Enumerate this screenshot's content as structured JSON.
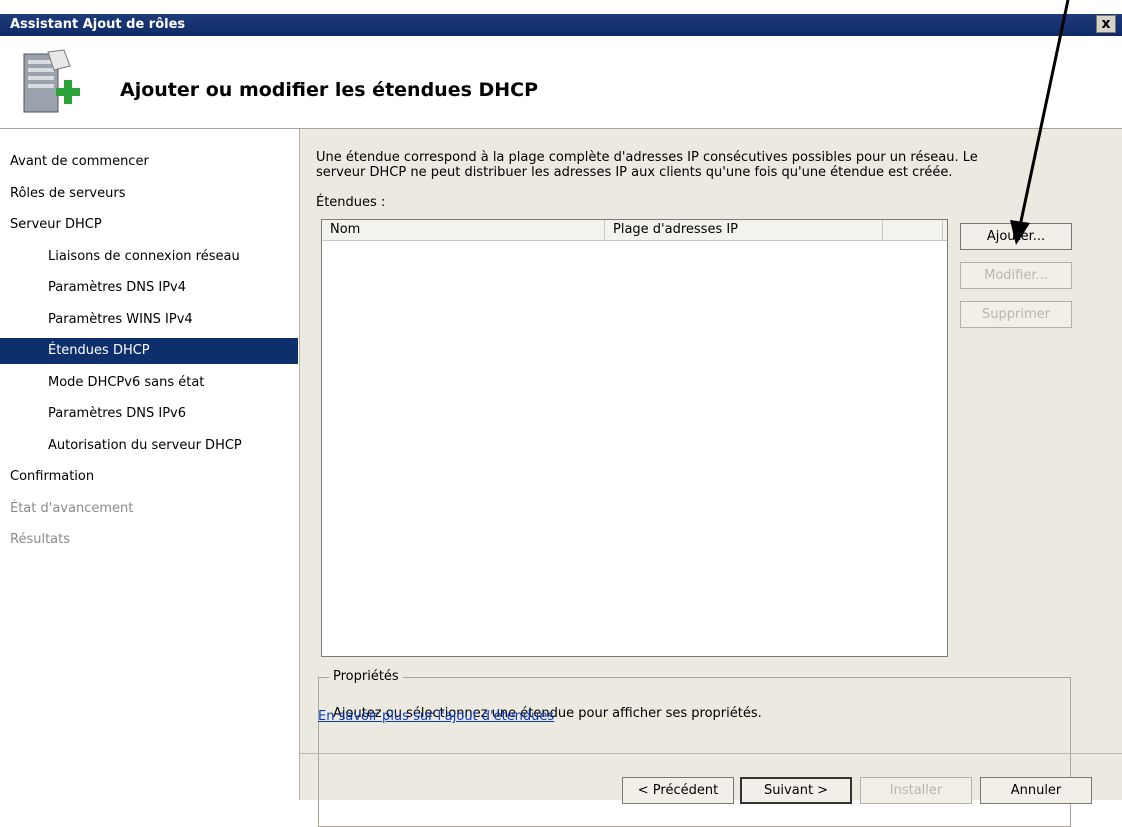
{
  "window": {
    "title": "Assistant Ajout de rôles",
    "close_label": "x"
  },
  "header": {
    "title": "Ajouter ou modifier les étendues DHCP",
    "icon": "server-add-icon"
  },
  "nav": {
    "items": [
      {
        "label": "Avant de commencer",
        "level": 0,
        "state": "normal"
      },
      {
        "label": "Rôles de serveurs",
        "level": 0,
        "state": "normal"
      },
      {
        "label": "Serveur DHCP",
        "level": 0,
        "state": "normal"
      },
      {
        "label": "Liaisons de connexion réseau",
        "level": 1,
        "state": "normal"
      },
      {
        "label": "Paramètres DNS IPv4",
        "level": 1,
        "state": "normal"
      },
      {
        "label": "Paramètres WINS IPv4",
        "level": 1,
        "state": "normal"
      },
      {
        "label": "Étendues DHCP",
        "level": 1,
        "state": "selected"
      },
      {
        "label": "Mode DHCPv6 sans état",
        "level": 1,
        "state": "normal"
      },
      {
        "label": "Paramètres DNS IPv6",
        "level": 1,
        "state": "normal"
      },
      {
        "label": "Autorisation du serveur DHCP",
        "level": 1,
        "state": "normal"
      },
      {
        "label": "Confirmation",
        "level": 0,
        "state": "normal"
      },
      {
        "label": "État d'avancement",
        "level": 0,
        "state": "disabled"
      },
      {
        "label": "Résultats",
        "level": 0,
        "state": "disabled"
      }
    ]
  },
  "main": {
    "intro_line1": "Une étendue correspond à la plage complète d'adresses IP consécutives possibles pour un réseau. Le",
    "intro_line2": "serveur DHCP ne peut distribuer les adresses IP aux clients qu'une fois qu'une étendue est créée.",
    "scopes_label": "Étendues :",
    "columns": [
      "Nom",
      "Plage d'adresses IP"
    ],
    "buttons": {
      "add": "Ajouter...",
      "modify": "Modifier...",
      "delete": "Supprimer"
    },
    "properties": {
      "legend": "Propriétés",
      "text": "Ajoutez ou sélectionnez une étendue pour afficher ses propriétés."
    },
    "link": "En savoir plus sur l'ajout d'étendues"
  },
  "footer": {
    "previous": "< Précédent",
    "next": "Suivant >",
    "install": "Installer",
    "cancel": "Annuler"
  },
  "colors": {
    "titlebar": "#0f2b67",
    "selected": "#0d2f6b",
    "panel": "#ece9e1",
    "link": "#0a3bbf"
  }
}
